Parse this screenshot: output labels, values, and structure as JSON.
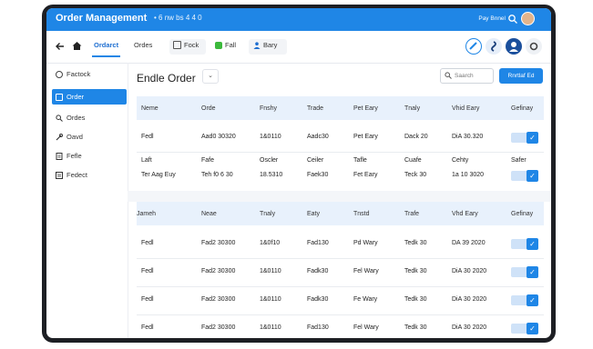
{
  "window": {
    "title": "Order Management",
    "subtitle": "• 6 nw bs 4 4 0",
    "user": "Pay Bnnel"
  },
  "toolbar": {
    "items": [
      {
        "label": "Ordarct",
        "active": true
      },
      {
        "label": "Ordes",
        "active": false
      },
      {
        "label": "Fock",
        "active": false
      },
      {
        "label": "Fall",
        "active": false
      },
      {
        "label": "Bary",
        "active": false
      }
    ]
  },
  "sidebar": {
    "items": [
      {
        "label": "Factock",
        "icon": "clock-icon"
      },
      {
        "label": "Order",
        "icon": "cart-icon",
        "active": true
      },
      {
        "label": "Ordes",
        "icon": "search-icon"
      },
      {
        "label": "Oavd",
        "icon": "wrench-icon"
      },
      {
        "label": "Fefle",
        "icon": "file-icon"
      },
      {
        "label": "Fedect",
        "icon": "list-icon"
      }
    ]
  },
  "main": {
    "title": "Endle Order",
    "search_placeholder": "Saarch",
    "primary_button": "Rnrtlaf Ed"
  },
  "table1": {
    "headers": [
      "Neme",
      "Orde",
      "Fnshy",
      "Trade",
      "Pet Eary",
      "Tnaly",
      "Vhid Eary",
      "Gefinay"
    ],
    "rows": [
      [
        "Fedl",
        "Aad0 30320",
        "1&0110",
        "Aadc30",
        "Pet Eary",
        "Dack 20",
        "DiA 30.320"
      ],
      [
        "Laft",
        "Fafe",
        "Oscler",
        "Ceiler",
        "Tafle",
        "Cuafe",
        "Cehty"
      ],
      [
        "Ter Aag Euy",
        "Teh f0 6 30",
        "18.5310",
        "Faek30",
        "Fet Eary",
        "Teck 30",
        "1a 10 3020"
      ]
    ],
    "extra_label": "Safer"
  },
  "table2": {
    "headers": [
      "Jameh",
      "Neae",
      "Tnaly",
      "Eaty",
      "Tnstd",
      "Trafe",
      "Vhd Eary",
      "Gefinay"
    ],
    "rows": [
      [
        "Fedl",
        "Fad2 30300",
        "1&0f10",
        "Fad130",
        "Pd Wary",
        "Tedk 30",
        "DA 39 2020"
      ],
      [
        "Fedl",
        "Fad2 30300",
        "1&0110",
        "Fadk30",
        "Fel Wary",
        "Tedk 30",
        "DiA 30 2020"
      ],
      [
        "Fedl",
        "Fad2 30300",
        "1&0110",
        "Fadk30",
        "Fe Wary",
        "Tedk 30",
        "DiA 30 2020"
      ],
      [
        "Fedl",
        "Fad2 30300",
        "1&0110",
        "Fad130",
        "Fel Wary",
        "Tedk 30",
        "DiA 30 2020"
      ]
    ]
  },
  "colors": {
    "accent": "#1f86e6",
    "header_row": "#e8f1fc",
    "frame": "#1d1f24"
  }
}
